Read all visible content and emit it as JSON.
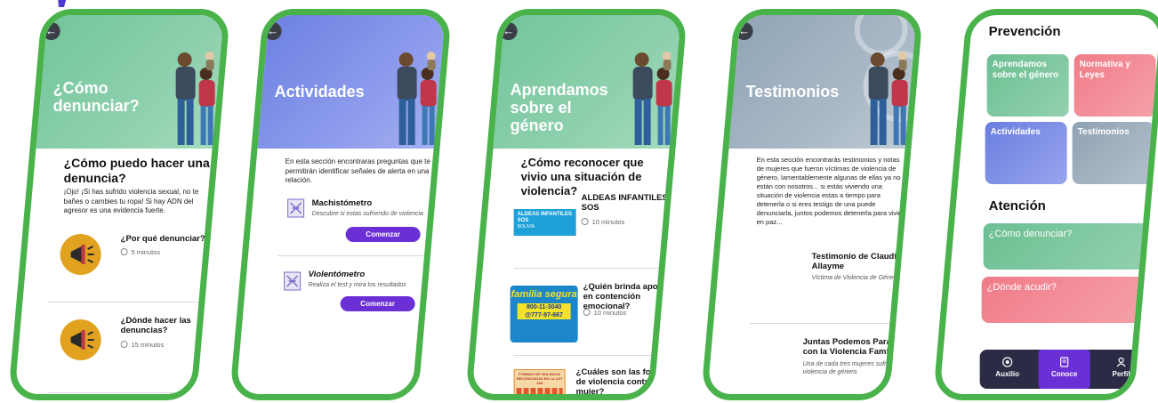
{
  "colors": {
    "frame": "#49b24a",
    "accent": "#6b2fd6",
    "green": "#6fc49a",
    "pink": "#f07c88",
    "blue": "#6a7ee0",
    "grey": "#8ea3b5",
    "nav": "#2c2b45"
  },
  "screen1": {
    "hero_title": "¿Cómo denunciar?",
    "section_title": "¿Cómo puedo hacer una denuncia?",
    "body": "¡Ojo! ¡Si has sufrido violencia sexual, no te bañes o cambies tu ropa! Si hay ADN del agresor es una evidencia fuerte.",
    "items": [
      {
        "title": "¿Por qué denunciar?",
        "duration": "5 minutos",
        "icon": "megaphone-icon"
      },
      {
        "title": "¿Dónde hacer las denuncias?",
        "duration": "15 minutos",
        "icon": "megaphone-icon"
      }
    ]
  },
  "screen2": {
    "hero_title": "Actividades",
    "body": "En esta sección encontraras preguntas que te permitirán identificar señales de alerta en una relación.",
    "items": [
      {
        "title": "Machistómetro",
        "desc": "Descubre si estas sufriendo de violencia",
        "button": "Comenzar"
      },
      {
        "title": "Violentómetro",
        "desc": "Realiza el test y mira los resultados",
        "button": "Comenzar"
      }
    ]
  },
  "screen3": {
    "hero_title": "Aprendamos sobre el género",
    "section_title": "¿Cómo reconocer que vivio una situación de violencia?",
    "items": [
      {
        "title": "ALDEAS INFANTILES SOS",
        "duration": "10 minutos",
        "logo_text": "ALDEAS INFANTILES SOS",
        "logo_sub": "BOLIVIA"
      },
      {
        "title": "¿Quién brinda apoyo en contención emocional?",
        "duration": "10 minutos",
        "logo_text": "familia segura",
        "logo_phone1": "800-11-3040",
        "logo_phone2": "@777-97-667"
      },
      {
        "title": "¿Cuáles son las formas de violencia contra la mujer?",
        "logo_text": "FORMAS DE VIOLENCIA RECONOCIDAS EN LA LEY 348"
      }
    ]
  },
  "screen4": {
    "hero_title": "Testimonios",
    "body": "En esta sección encontrarás testimonios y notas de mujeres que fueron víctimas de violencia de género, lamentablemente algunas de ellas ya no están con nosotros... si estás viviendo una situación de violencia estas a tiempo para detenerla o si eres testigo de una puede denunciarla, juntos podemos detenerla para vivir en paz...",
    "items": [
      {
        "title": "Testimonio de Claudia Allayme",
        "desc": "Víctima de Violencia de Género"
      },
      {
        "title": "Juntas Podemos Parar con la Violencia Familiar",
        "desc": "Una de cada tres mujeres sufre de violencia de género"
      }
    ]
  },
  "screen5": {
    "prevencion_title": "Prevención",
    "prevencion_tiles": [
      {
        "label": "Aprendamos sobre el género"
      },
      {
        "label": "Normativa y Leyes"
      },
      {
        "label": "Actividades"
      },
      {
        "label": "Testimonios"
      }
    ],
    "atencion_title": "Atención",
    "atencion_tiles": [
      {
        "label": "¿Cómo denunciar?"
      },
      {
        "label": "¿Dónde acudir?"
      }
    ],
    "nav": [
      {
        "label": "Auxilio",
        "icon": "help-icon"
      },
      {
        "label": "Conoce",
        "icon": "book-icon"
      },
      {
        "label": "Perfil",
        "icon": "user-icon"
      }
    ]
  }
}
